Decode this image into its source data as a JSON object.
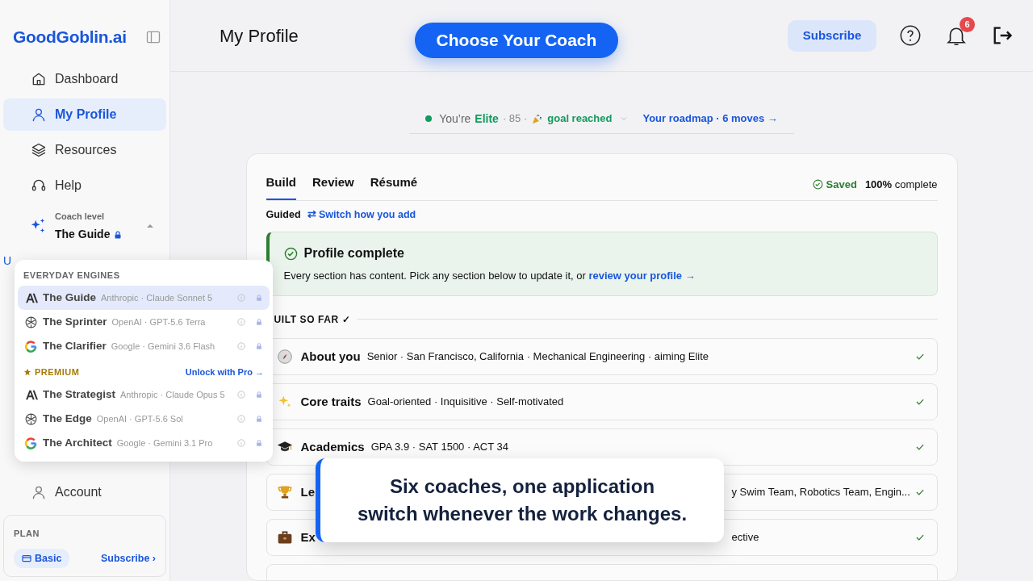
{
  "sidebar": {
    "logo": "GoodGoblin.ai",
    "items": [
      {
        "label": "Dashboard",
        "selected": false
      },
      {
        "label": "My Profile",
        "selected": true
      },
      {
        "label": "Resources",
        "selected": false
      },
      {
        "label": "Help",
        "selected": false
      }
    ],
    "coach_level": {
      "caption": "Coach level",
      "value": "The Guide",
      "locked": true,
      "expanded": true
    },
    "partial_link": "U",
    "account": {
      "label": "Account"
    },
    "plan": {
      "title": "PLAN",
      "badge": "Basic",
      "link": "Subscribe ›"
    }
  },
  "header": {
    "title": "My Profile",
    "coach_button": "Choose Your Coach",
    "subscribe": "Subscribe",
    "notifications": "6"
  },
  "status": {
    "prefix": "You’re",
    "tier": "Elite",
    "score": "· 85 ·",
    "goal": "goal reached",
    "roadmap": "Your roadmap · 6 moves →"
  },
  "card": {
    "tabs": [
      {
        "label": "Build",
        "selected": true
      },
      {
        "label": "Review",
        "selected": false
      },
      {
        "label": "Résumé",
        "selected": false
      }
    ],
    "saved": "Saved",
    "completion": "**100%** complete",
    "mode": "Guided",
    "switch_link": "⇄ Switch how you add",
    "alert": {
      "title": "Profile complete",
      "text": "Every section has content. Pick any section below to update it, or",
      "link": "review your profile →"
    },
    "section_heading": "UILT SO FAR ✓",
    "rows": [
      {
        "kind": "full",
        "title": "About you",
        "detail": "Senior · San Francisco, California · Mechanical Engineering · aiming Elite",
        "done": true
      },
      {
        "kind": "full",
        "title": "Core traits",
        "detail": "Goal-oriented · Inquisitive · Self-motivated",
        "done": true
      },
      {
        "kind": "full",
        "title": "Academics",
        "detail": "GPA 3.9 · SAT 1500 · ACT 34",
        "done": true
      },
      {
        "kind": "covered",
        "title": "Le",
        "detail": "y Swim Team, Robotics Team, Engin...",
        "done": true
      },
      {
        "kind": "covered",
        "title": "Ex",
        "detail": "ective",
        "done": true
      }
    ]
  },
  "coach_menu": {
    "groups": [
      {
        "heading": "EVERYDAY ENGINES",
        "premium": false,
        "items": [
          {
            "name": "The Guide",
            "model": "Anthropic · Claude Sonnet 5",
            "kind": "anthropic",
            "selected": true
          },
          {
            "name": "The Sprinter",
            "model": "OpenAI · GPT-5.6 Terra",
            "kind": "openai",
            "selected": false
          },
          {
            "name": "The Clarifier",
            "model": "Google · Gemini 3.6 Flash",
            "kind": "google",
            "selected": false
          }
        ]
      },
      {
        "heading": "PREMIUM",
        "premium": true,
        "action": "Unlock with Pro →",
        "items": [
          {
            "name": "The Strategist",
            "model": "Anthropic · Claude Opus 5",
            "kind": "anthropic",
            "selected": false
          },
          {
            "name": "The Edge",
            "model": "OpenAI · GPT-5.6 Sol",
            "kind": "openai",
            "selected": false
          },
          {
            "name": "The Architect",
            "model": "Google · Gemini 3.1 Pro",
            "kind": "google",
            "selected": false
          }
        ]
      }
    ]
  },
  "caption": {
    "lines": [
      "Six coaches, one application",
      "switch whenever the work changes."
    ]
  }
}
